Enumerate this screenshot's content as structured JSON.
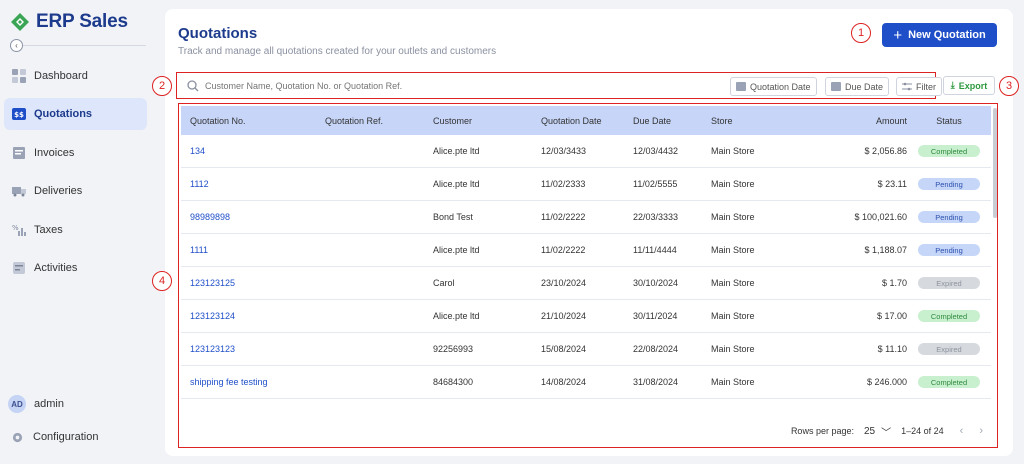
{
  "brand": {
    "name": "ERP Sales",
    "accent": "#1d3b8c",
    "logo_color": "#3aa655"
  },
  "sidebar": {
    "items": [
      {
        "label": "Dashboard",
        "icon": "dashboard-icon",
        "active": false
      },
      {
        "label": "Quotations",
        "icon": "quotation-icon",
        "active": true
      },
      {
        "label": "Invoices",
        "icon": "invoice-icon",
        "active": false
      },
      {
        "label": "Deliveries",
        "icon": "truck-icon",
        "active": false
      },
      {
        "label": "Taxes",
        "icon": "tax-icon",
        "active": false
      },
      {
        "label": "Activities",
        "icon": "activity-icon",
        "active": false
      }
    ],
    "user": {
      "initials": "AD",
      "name": "admin"
    },
    "config_label": "Configuration"
  },
  "header": {
    "title": "Quotations",
    "subtitle": "Track and manage all quotations created for your outlets and customers",
    "new_button": "New Quotation"
  },
  "markers": [
    "1",
    "2",
    "3",
    "4"
  ],
  "filters": {
    "search_placeholder": "Customer Name, Quotation No. or Quotation Ref.",
    "quotation_date": "Quotation Date",
    "due_date": "Due Date",
    "filter": "Filter",
    "export": "Export"
  },
  "table": {
    "columns": [
      "Quotation No.",
      "Quotation Ref.",
      "Customer",
      "Quotation Date",
      "Due Date",
      "Store",
      "Amount",
      "Status"
    ],
    "rows": [
      {
        "no": "134",
        "ref": "",
        "customer": "Alice.pte ltd",
        "qdate": "12/03/3433",
        "due": "12/03/4432",
        "store": "Main Store",
        "amount": "$ 2,056.86",
        "status": "Completed",
        "status_type": "completed"
      },
      {
        "no": "1112",
        "ref": "",
        "customer": "Alice.pte ltd",
        "qdate": "11/02/2333",
        "due": "11/02/5555",
        "store": "Main Store",
        "amount": "$ 23.11",
        "status": "Pending",
        "status_type": "pending"
      },
      {
        "no": "98989898",
        "ref": "",
        "customer": "Bond Test",
        "qdate": "11/02/2222",
        "due": "22/03/3333",
        "store": "Main Store",
        "amount": "$ 100,021.60",
        "status": "Pending",
        "status_type": "pending"
      },
      {
        "no": "1111",
        "ref": "",
        "customer": "Alice.pte ltd",
        "qdate": "11/02/2222",
        "due": "11/11/4444",
        "store": "Main Store",
        "amount": "$ 1,188.07",
        "status": "Pending",
        "status_type": "pending"
      },
      {
        "no": "123123125",
        "ref": "",
        "customer": "Carol",
        "qdate": "23/10/2024",
        "due": "30/10/2024",
        "store": "Main Store",
        "amount": "$ 1.70",
        "status": "Expired",
        "status_type": "expired"
      },
      {
        "no": "123123124",
        "ref": "",
        "customer": "Alice.pte ltd",
        "qdate": "21/10/2024",
        "due": "30/11/2024",
        "store": "Main Store",
        "amount": "$ 17.00",
        "status": "Completed",
        "status_type": "completed"
      },
      {
        "no": "123123123",
        "ref": "",
        "customer": "92256993",
        "qdate": "15/08/2024",
        "due": "22/08/2024",
        "store": "Main Store",
        "amount": "$ 11.10",
        "status": "Expired",
        "status_type": "expired"
      },
      {
        "no": "shipping fee testing",
        "ref": "",
        "customer": "84684300",
        "qdate": "14/08/2024",
        "due": "31/08/2024",
        "store": "Main Store",
        "amount": "$ 246.000",
        "status": "Completed",
        "status_type": "completed"
      }
    ],
    "rows_per_page_label": "Rows per page:",
    "rows_per_page": "25",
    "range": "1–24 of 24"
  }
}
